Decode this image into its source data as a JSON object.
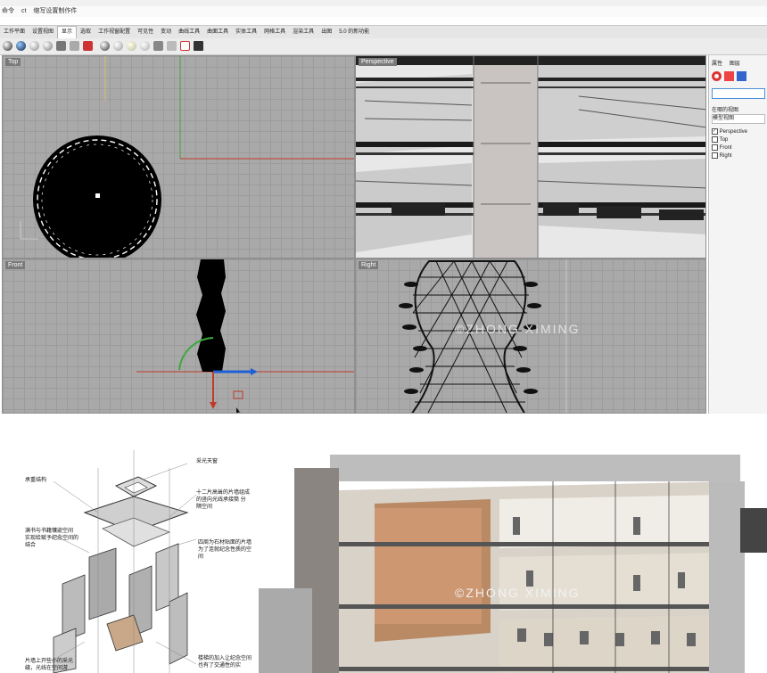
{
  "window": {
    "command_line": [
      "命令",
      "ct",
      "缩写设置制作件"
    ]
  },
  "ribbon": {
    "tabs": [
      "工作平面",
      "设置视图",
      "显示",
      "选取",
      "工作视窗配置",
      "可见性",
      "变动",
      "曲线工具",
      "曲面工具",
      "实体工具",
      "网格工具",
      "渲染工具",
      "出图",
      "5.0 的新功能"
    ],
    "active_index": 2
  },
  "viewports": {
    "top": {
      "label": "Top"
    },
    "perspective": {
      "label": "Perspective"
    },
    "front": {
      "label": "Front"
    },
    "right": {
      "label": "Right"
    }
  },
  "properties_panel": {
    "tabs": [
      "属性",
      "图层"
    ],
    "section_title": "在哪的视图",
    "dropdown_value": "模型视图",
    "views": [
      {
        "label": "Perspective",
        "checked": true
      },
      {
        "label": "Top",
        "checked": false
      },
      {
        "label": "Front",
        "checked": false
      },
      {
        "label": "Right",
        "checked": false
      }
    ]
  },
  "watermark": "©ZHONG XIMING",
  "diagram_annotations": {
    "skylight": "采光天窗",
    "bearing": "承重结构",
    "twelve_panels": "十二片高耸的片墙组成的竖向光线承接筒  分隔空间",
    "bookshelf": "满书与书籍镶嵌空间 实现给赋予纪念空间的结合",
    "four_sides": "四周为石材贴面的片墙为了连就纪念性质的空间",
    "small_lights": "片墙上开些小的采光缝，光线在空间游",
    "joined": "楼梯的加入让纪念空间也有了交通性的实"
  },
  "colors": {
    "viewport_grid": "#a9a9a9",
    "axis_red": "#c0392b",
    "axis_green": "#3aa83a",
    "gumball_blue": "#1e5fd6",
    "panel_bg": "#f4f4f4"
  }
}
